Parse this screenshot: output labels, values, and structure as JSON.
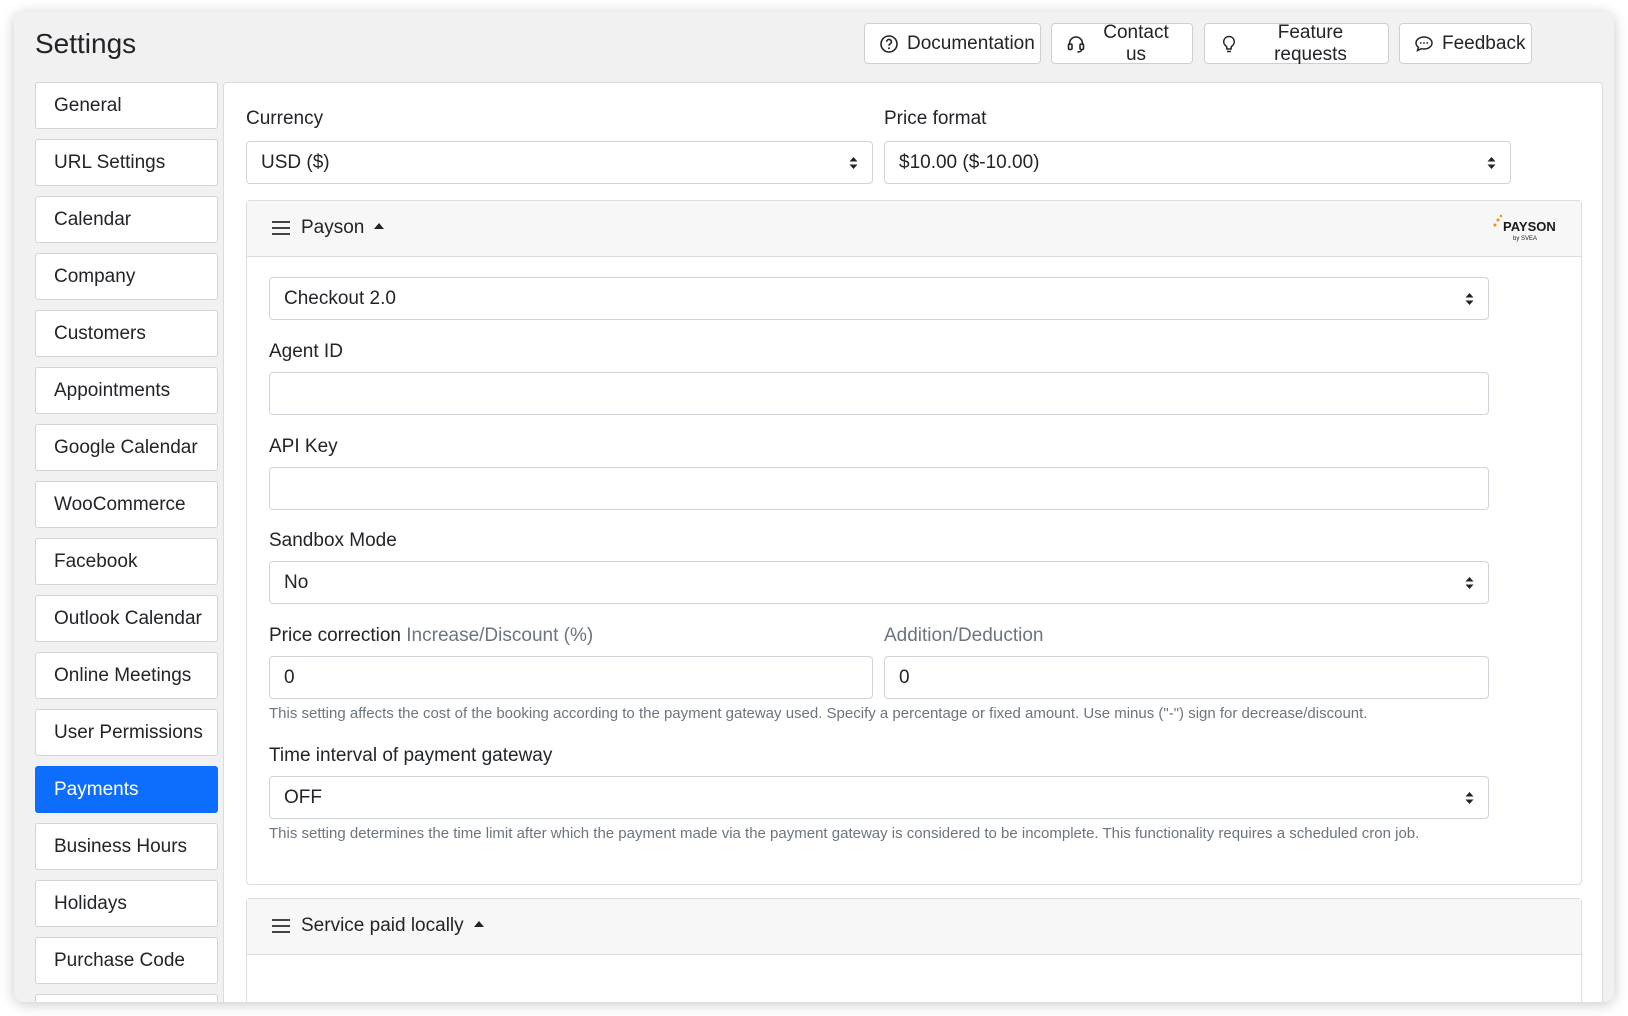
{
  "page": {
    "title": "Settings"
  },
  "header_buttons": [
    {
      "label": "Documentation",
      "icon": "question-circle-icon"
    },
    {
      "label": "Contact us",
      "icon": "headset-icon"
    },
    {
      "label": "Feature requests",
      "icon": "lightbulb-icon"
    },
    {
      "label": "Feedback",
      "icon": "chat-bubble-icon"
    }
  ],
  "sidebar": {
    "items": [
      {
        "label": "General"
      },
      {
        "label": "URL Settings"
      },
      {
        "label": "Calendar"
      },
      {
        "label": "Company"
      },
      {
        "label": "Customers"
      },
      {
        "label": "Appointments"
      },
      {
        "label": "Google Calendar"
      },
      {
        "label": "WooCommerce"
      },
      {
        "label": "Facebook"
      },
      {
        "label": "Outlook Calendar"
      },
      {
        "label": "Online Meetings"
      },
      {
        "label": "User Permissions"
      },
      {
        "label": "Payments",
        "active": true
      },
      {
        "label": "Business Hours"
      },
      {
        "label": "Holidays"
      },
      {
        "label": "Purchase Code"
      }
    ]
  },
  "payments": {
    "currency_label": "Currency",
    "currency_value": "USD ($)",
    "price_format_label": "Price format",
    "price_format_value": "$10.00 ($-10.00)",
    "payson": {
      "title": "Payson",
      "logo_text": "PAYSON",
      "logo_sub": "by SVEA",
      "checkout_value": "Checkout 2.0",
      "agent_id_label": "Agent ID",
      "agent_id_value": "",
      "api_key_label": "API Key",
      "api_key_value": "",
      "sandbox_label": "Sandbox Mode",
      "sandbox_value": "No",
      "price_correction_label": "Price correction",
      "price_correction_sub": "Increase/Discount (%)",
      "increase_value": "0",
      "addition_label": "Addition/Deduction",
      "addition_value": "0",
      "price_correction_help": "This setting affects the cost of the booking according to the payment gateway used. Specify a percentage or fixed amount. Use minus (\"-\") sign for decrease/discount.",
      "time_interval_label": "Time interval of payment gateway",
      "time_interval_value": "OFF",
      "time_interval_help": "This setting determines the time limit after which the payment made via the payment gateway is considered to be incomplete. This functionality requires a scheduled cron job."
    },
    "service_local": {
      "title": "Service paid locally"
    }
  },
  "colors": {
    "accent": "#0d6efd",
    "logo_orange": "#f28c00"
  }
}
